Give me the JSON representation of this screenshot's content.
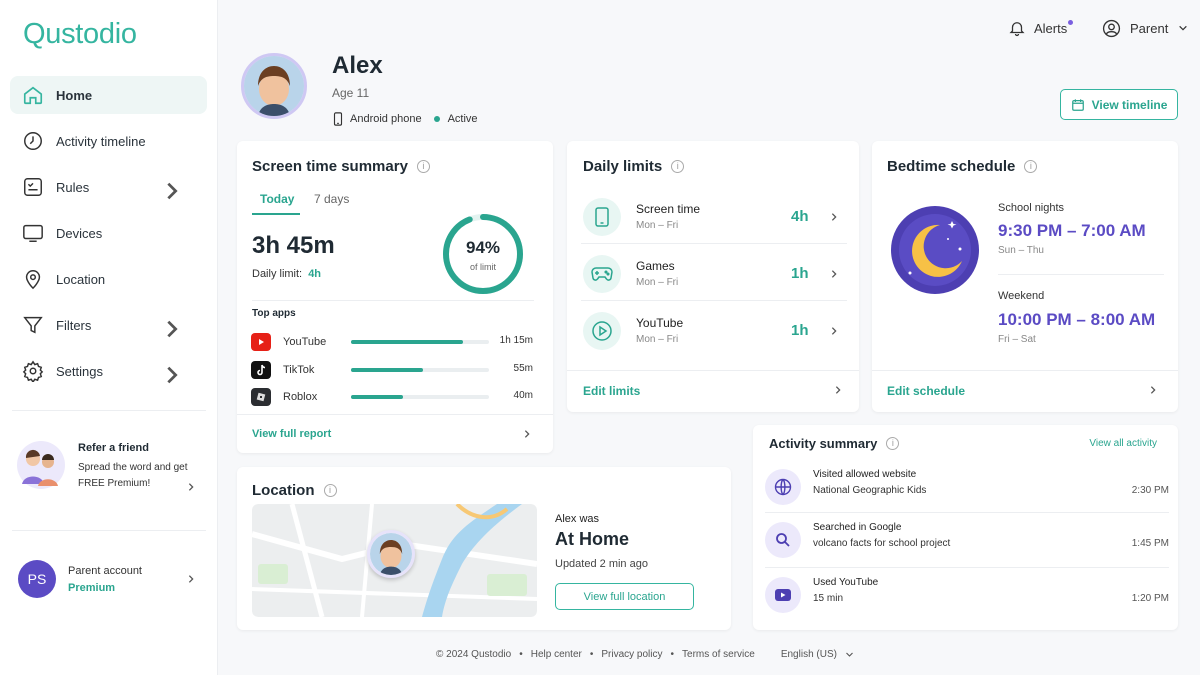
{
  "brand": {
    "name": "Qustodio",
    "accent": "#35b5a0",
    "purple": "#5b4bc4"
  },
  "sidebar": {
    "items": [
      {
        "label": "Home",
        "icon": "home-icon",
        "active": true,
        "chevron": false
      },
      {
        "label": "Activity timeline",
        "icon": "clock-icon",
        "active": false,
        "chevron": false
      },
      {
        "label": "Rules",
        "icon": "rules-icon",
        "active": false,
        "chevron": true
      },
      {
        "label": "Devices",
        "icon": "monitor-icon",
        "active": false,
        "chevron": false
      },
      {
        "label": "Location",
        "icon": "location-pin-icon",
        "active": false,
        "chevron": false
      },
      {
        "label": "Filters",
        "icon": "filter-icon",
        "active": false,
        "chevron": true
      },
      {
        "label": "Settings",
        "icon": "gear-icon",
        "active": false,
        "chevron": true
      }
    ],
    "refer": {
      "title": "Refer a friend",
      "text": "Spread the word and get FREE Premium!"
    },
    "account": {
      "initials": "PS",
      "label": "Parent account",
      "plan": "Premium"
    }
  },
  "topbar": {
    "alerts": "Alerts",
    "user": "Parent"
  },
  "profile": {
    "name": "Alex",
    "age": "Age 11",
    "device": "Android phone",
    "status": "Active",
    "timeline_button": "View timeline"
  },
  "screen_time": {
    "title": "Screen time summary",
    "tabs": [
      "Today",
      "7 days"
    ],
    "total": "3h 45m",
    "limit_label": "Daily limit:",
    "limit_value": "4h",
    "percent": "94%",
    "percent_value": 0.94,
    "percent_caption": "of limit",
    "top_apps_label": "Top apps",
    "apps": [
      {
        "name": "YouTube",
        "time": "1h 15m",
        "fraction": 0.81
      },
      {
        "name": "TikTok",
        "time": "55m",
        "fraction": 0.52
      },
      {
        "name": "Roblox",
        "time": "40m",
        "fraction": 0.38
      }
    ],
    "link": "View full report"
  },
  "daily_limits": {
    "title": "Daily limits",
    "items": [
      {
        "name": "Screen time",
        "days": "Mon – Fri",
        "value": "4h"
      },
      {
        "name": "Games",
        "days": "Mon – Fri",
        "value": "1h"
      },
      {
        "name": "YouTube",
        "days": "Mon – Fri",
        "value": "1h"
      }
    ],
    "link": "Edit limits"
  },
  "bedtime": {
    "title": "Bedtime schedule",
    "school": {
      "label": "School nights",
      "time": "9:30 PM – 7:00 AM",
      "days": "Sun – Thu"
    },
    "weekend": {
      "label": "Weekend",
      "time": "10:00 PM – 8:00 AM",
      "days": "Fri – Sat"
    },
    "link": "Edit schedule"
  },
  "location": {
    "title": "Location",
    "was": "Alex was",
    "place": "At Home",
    "updated": "Updated 2 min ago",
    "button": "View full location"
  },
  "activity": {
    "title": "Activity summary",
    "link": "View all activity",
    "items": [
      {
        "title": "Visited allowed website",
        "detail": "National Geographic Kids",
        "time": "2:30 PM"
      },
      {
        "title": "Searched in Google",
        "detail": "volcano facts for school project",
        "time": "1:45 PM"
      },
      {
        "title": "Used YouTube",
        "detail": "15 min",
        "time": "1:20 PM"
      }
    ]
  },
  "footer": {
    "copyright": "© 2024 Qustodio",
    "help": "Help center",
    "privacy": "Privacy policy",
    "terms": "Terms of service",
    "language": "English (US)"
  }
}
